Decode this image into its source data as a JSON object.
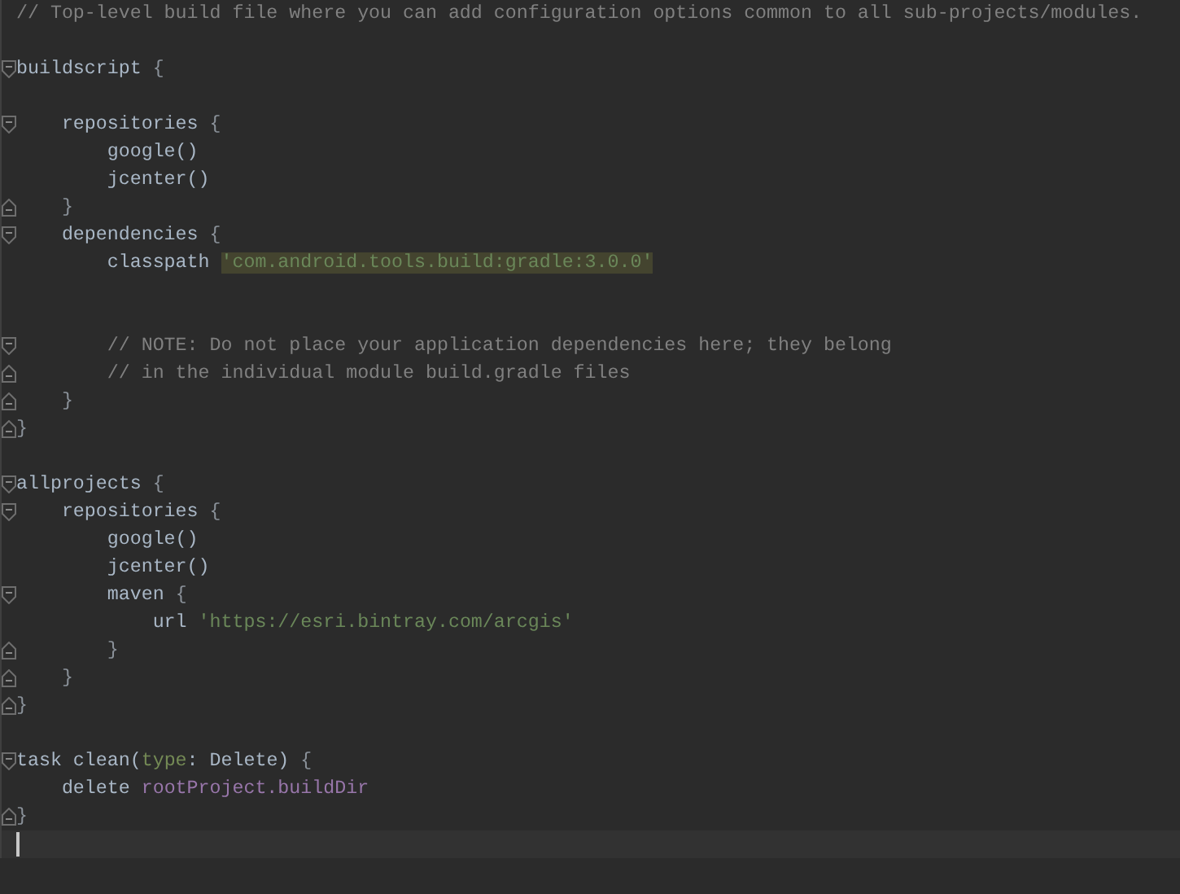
{
  "editor": {
    "lines": [
      {
        "kind": "code",
        "tokens": [
          {
            "kind": "comment",
            "text": "// Top-level build file where you can add configuration options common to all sub-projects/modules."
          }
        ]
      },
      {
        "kind": "blank"
      },
      {
        "kind": "code",
        "fold_start": true,
        "tokens": [
          {
            "kind": "plain",
            "text": "buildscript "
          },
          {
            "kind": "brace",
            "text": "{"
          }
        ]
      },
      {
        "kind": "blank"
      },
      {
        "kind": "code",
        "fold_start": true,
        "tokens": [
          {
            "kind": "plain",
            "text": "    repositories "
          },
          {
            "kind": "brace",
            "text": "{"
          }
        ]
      },
      {
        "kind": "code",
        "tokens": [
          {
            "kind": "plain",
            "text": "        google()"
          }
        ]
      },
      {
        "kind": "code",
        "tokens": [
          {
            "kind": "plain",
            "text": "        jcenter()"
          }
        ]
      },
      {
        "kind": "code",
        "fold_end": true,
        "tokens": [
          {
            "kind": "brace",
            "text": "    }"
          }
        ]
      },
      {
        "kind": "code",
        "fold_start": true,
        "tokens": [
          {
            "kind": "plain",
            "text": "    dependencies "
          },
          {
            "kind": "brace",
            "text": "{"
          }
        ]
      },
      {
        "kind": "code",
        "tokens": [
          {
            "kind": "plain",
            "text": "        classpath "
          },
          {
            "kind": "string-highlighted",
            "text": "'com.android.tools.build:gradle:3.0.0'"
          }
        ]
      },
      {
        "kind": "blank"
      },
      {
        "kind": "blank"
      },
      {
        "kind": "code",
        "fold_start": true,
        "tokens": [
          {
            "kind": "comment",
            "text": "        // NOTE: Do not place your application dependencies here; they belong"
          }
        ]
      },
      {
        "kind": "code",
        "fold_end": true,
        "tokens": [
          {
            "kind": "comment",
            "text": "        // in the individual module build.gradle files"
          }
        ]
      },
      {
        "kind": "code",
        "fold_end": true,
        "tokens": [
          {
            "kind": "brace",
            "text": "    }"
          }
        ]
      },
      {
        "kind": "code",
        "fold_end": true,
        "tokens": [
          {
            "kind": "brace",
            "text": "}"
          }
        ]
      },
      {
        "kind": "blank"
      },
      {
        "kind": "code",
        "fold_start": true,
        "tokens": [
          {
            "kind": "plain",
            "text": "allprojects "
          },
          {
            "kind": "brace",
            "text": "{"
          }
        ]
      },
      {
        "kind": "code",
        "fold_start": true,
        "tokens": [
          {
            "kind": "plain",
            "text": "    repositories "
          },
          {
            "kind": "brace",
            "text": "{"
          }
        ]
      },
      {
        "kind": "code",
        "tokens": [
          {
            "kind": "plain",
            "text": "        google()"
          }
        ]
      },
      {
        "kind": "code",
        "tokens": [
          {
            "kind": "plain",
            "text": "        jcenter()"
          }
        ]
      },
      {
        "kind": "code",
        "fold_start": true,
        "tokens": [
          {
            "kind": "plain",
            "text": "        maven "
          },
          {
            "kind": "brace",
            "text": "{"
          }
        ]
      },
      {
        "kind": "code",
        "tokens": [
          {
            "kind": "plain",
            "text": "            url "
          },
          {
            "kind": "string",
            "text": "'https://esri.bintray.com/arcgis'"
          }
        ]
      },
      {
        "kind": "code",
        "fold_end": true,
        "tokens": [
          {
            "kind": "brace",
            "text": "        }"
          }
        ]
      },
      {
        "kind": "code",
        "fold_end": true,
        "tokens": [
          {
            "kind": "brace",
            "text": "    }"
          }
        ]
      },
      {
        "kind": "code",
        "fold_end": true,
        "tokens": [
          {
            "kind": "brace",
            "text": "}"
          }
        ]
      },
      {
        "kind": "blank"
      },
      {
        "kind": "code",
        "fold_start": true,
        "tokens": [
          {
            "kind": "plain",
            "text": "task clean("
          },
          {
            "kind": "param",
            "text": "type"
          },
          {
            "kind": "plain",
            "text": ": Delete) "
          },
          {
            "kind": "brace",
            "text": "{"
          }
        ]
      },
      {
        "kind": "code",
        "tokens": [
          {
            "kind": "plain",
            "text": "    delete "
          },
          {
            "kind": "property",
            "text": "rootProject.buildDir"
          }
        ]
      },
      {
        "kind": "code",
        "fold_end": true,
        "tokens": [
          {
            "kind": "brace",
            "text": "}"
          }
        ]
      },
      {
        "kind": "caret"
      }
    ]
  }
}
